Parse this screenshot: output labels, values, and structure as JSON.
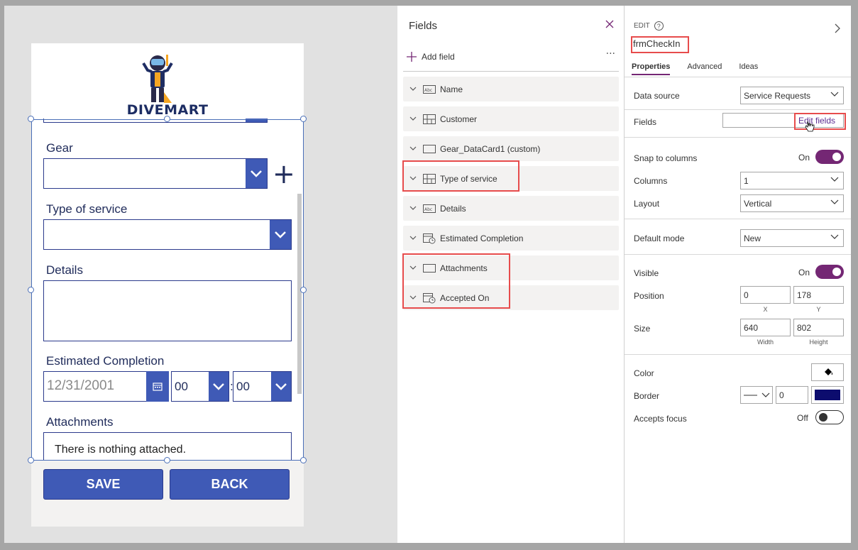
{
  "app": {
    "logo_text": "DIVEMART"
  },
  "form": {
    "gear_label": "Gear",
    "gear_value": "",
    "add_glyph": "+",
    "type_label": "Type of service",
    "type_value": "",
    "details_label": "Details",
    "details_value": "",
    "estimated_label": "Estimated Completion",
    "date_value": "12/31/2001",
    "hour_value": "00",
    "minute_value": "00",
    "time_separator": ":",
    "attachments_label": "Attachments",
    "attachments_text": "There is nothing attached.",
    "save_label": "SAVE",
    "back_label": "BACK"
  },
  "fields_panel": {
    "title": "Fields",
    "add_field_label": "Add field",
    "more": "···",
    "items": [
      {
        "label": "Name",
        "icon": "abc-text-icon"
      },
      {
        "label": "Customer",
        "icon": "grid-lookup-icon"
      },
      {
        "label": "Gear_DataCard1 (custom)",
        "icon": "rectangle-icon"
      },
      {
        "label": "Type of service",
        "icon": "grid-lookup-icon"
      },
      {
        "label": "Details",
        "icon": "abc-text-icon"
      },
      {
        "label": "Estimated Completion",
        "icon": "calendar-clock-icon"
      },
      {
        "label": "Attachments",
        "icon": "rectangle-icon"
      },
      {
        "label": "Accepted On",
        "icon": "calendar-clock-icon"
      }
    ]
  },
  "properties": {
    "section": "EDIT",
    "help_glyph": "?",
    "control_name": "frmCheckIn",
    "tabs": [
      "Properties",
      "Advanced",
      "Ideas"
    ],
    "data_source_label": "Data source",
    "data_source_value": "Service Requests",
    "fields_label": "Fields",
    "edit_fields_label": "Edit fields",
    "snap_label": "Snap to columns",
    "snap_state": "On",
    "columns_label": "Columns",
    "columns_value": "1",
    "layout_label": "Layout",
    "layout_value": "Vertical",
    "default_mode_label": "Default mode",
    "default_mode_value": "New",
    "visible_label": "Visible",
    "visible_state": "On",
    "position_label": "Position",
    "position_x": "0",
    "position_y": "178",
    "x_caption": "X",
    "y_caption": "Y",
    "size_label": "Size",
    "size_width": "640",
    "size_height": "802",
    "width_caption": "Width",
    "height_caption": "Height",
    "color_label": "Color",
    "border_label": "Border",
    "border_width": "0",
    "border_color": "#0c0c6e",
    "accepts_focus_label": "Accepts focus",
    "accepts_focus_state": "Off"
  },
  "colors": {
    "accent": "#742774",
    "form_blue": "#3f5ab6",
    "highlight": "#e74c4c"
  }
}
